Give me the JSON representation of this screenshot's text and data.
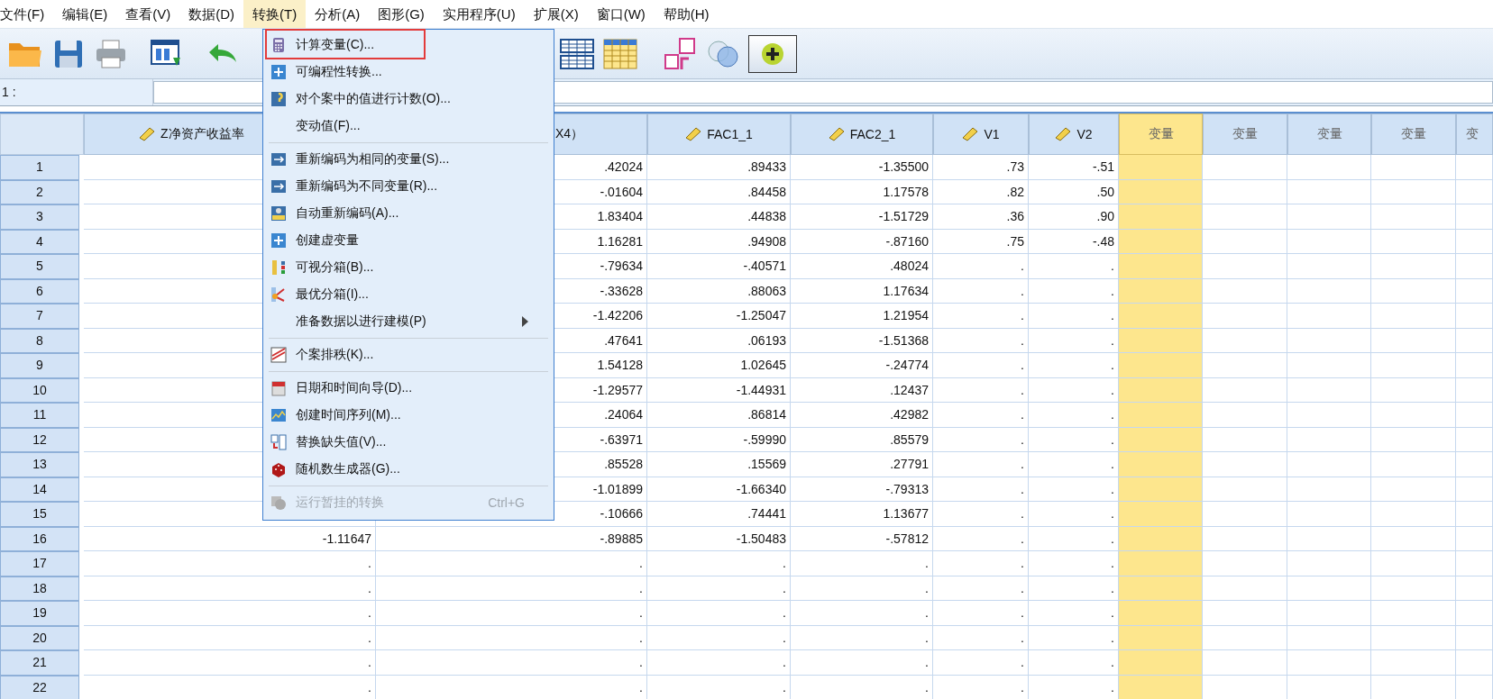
{
  "menu_bar": [
    {
      "label": "文件(F)",
      "selected": false
    },
    {
      "label": "编辑(E)",
      "selected": false
    },
    {
      "label": "查看(V)",
      "selected": false
    },
    {
      "label": "数据(D)",
      "selected": false
    },
    {
      "label": "转换(T)",
      "selected": true
    },
    {
      "label": "分析(A)",
      "selected": false
    },
    {
      "label": "图形(G)",
      "selected": false
    },
    {
      "label": "实用程序(U)",
      "selected": false
    },
    {
      "label": "扩展(X)",
      "selected": false
    },
    {
      "label": "窗口(W)",
      "selected": false
    },
    {
      "label": "帮助(H)",
      "selected": false
    }
  ],
  "cell_editor": {
    "cell_label": "1 :"
  },
  "transform_menu": {
    "items": [
      {
        "kind": "item",
        "label": "计算变量(C)...",
        "outlined": true,
        "disabled": false
      },
      {
        "kind": "item",
        "label": "可编程性转换...",
        "outlined": false,
        "disabled": false
      },
      {
        "kind": "item",
        "label": "对个案中的值进行计数(O)...",
        "outlined": false,
        "disabled": false
      },
      {
        "kind": "item",
        "label": "变动值(F)...",
        "outlined": false,
        "disabled": false
      },
      {
        "kind": "separator"
      },
      {
        "kind": "item",
        "label": "重新编码为相同的变量(S)...",
        "outlined": false,
        "disabled": false
      },
      {
        "kind": "item",
        "label": "重新编码为不同变量(R)...",
        "outlined": false,
        "disabled": false
      },
      {
        "kind": "item",
        "label": "自动重新编码(A)...",
        "outlined": false,
        "disabled": false
      },
      {
        "kind": "item",
        "label": "创建虚变量",
        "outlined": false,
        "disabled": false
      },
      {
        "kind": "item",
        "label": "可视分箱(B)...",
        "outlined": false,
        "disabled": false
      },
      {
        "kind": "item",
        "label": "最优分箱(I)...",
        "outlined": false,
        "disabled": false
      },
      {
        "kind": "submenu",
        "label": "准备数据以进行建模(P)",
        "outlined": false,
        "disabled": false
      },
      {
        "kind": "separator"
      },
      {
        "kind": "item",
        "label": "个案排秩(K)...",
        "outlined": false,
        "disabled": false
      },
      {
        "kind": "separator"
      },
      {
        "kind": "item",
        "label": "日期和时间向导(D)...",
        "outlined": false,
        "disabled": false
      },
      {
        "kind": "item",
        "label": "创建时间序列(M)...",
        "outlined": false,
        "disabled": false
      },
      {
        "kind": "item",
        "label": "替换缺失值(V)...",
        "outlined": false,
        "disabled": false
      },
      {
        "kind": "item",
        "label": "随机数生成器(G)...",
        "outlined": false,
        "disabled": false
      },
      {
        "kind": "separator"
      },
      {
        "kind": "item",
        "label": "运行暂挂的转换",
        "shortcut": "Ctrl+G",
        "outlined": false,
        "disabled": true
      }
    ]
  },
  "table": {
    "columns": [
      {
        "kind": "variable",
        "header": "Z净资产收益率",
        "selected": false
      },
      {
        "kind": "variable",
        "header": "X4）",
        "selected": false
      },
      {
        "kind": "variable",
        "header": "FAC1_1",
        "selected": false
      },
      {
        "kind": "variable",
        "header": "FAC2_1",
        "selected": false
      },
      {
        "kind": "variable",
        "header": "V1",
        "selected": false
      },
      {
        "kind": "variable",
        "header": "V2",
        "selected": false
      },
      {
        "kind": "empty",
        "header": "变量",
        "selected": true
      },
      {
        "kind": "empty",
        "header": "变量",
        "selected": false
      },
      {
        "kind": "empty",
        "header": "变量",
        "selected": false
      },
      {
        "kind": "empty",
        "header": "变量",
        "selected": false
      },
      {
        "kind": "empty",
        "header": "变",
        "selected": false
      }
    ],
    "rows": [
      {
        "number": "1",
        "cells": [
          null,
          ".42024",
          ".89433",
          "-1.35500",
          ".73",
          "-.51"
        ]
      },
      {
        "number": "2",
        "cells": [
          null,
          "-.01604",
          ".84458",
          "1.17578",
          ".82",
          ".50"
        ]
      },
      {
        "number": "3",
        "cells": [
          null,
          "1.83404",
          ".44838",
          "-1.51729",
          ".36",
          ".90"
        ]
      },
      {
        "number": "4",
        "cells": [
          null,
          "1.16281",
          ".94908",
          "-.87160",
          ".75",
          "-.48"
        ]
      },
      {
        "number": "5",
        "cells": [
          null,
          "-.79634",
          "-.40571",
          ".48024",
          ".",
          "."
        ]
      },
      {
        "number": "6",
        "cells": [
          null,
          "-.33628",
          ".88063",
          "1.17634",
          ".",
          "."
        ]
      },
      {
        "number": "7",
        "cells": [
          null,
          "-1.42206",
          "-1.25047",
          "1.21954",
          ".",
          "."
        ]
      },
      {
        "number": "8",
        "cells": [
          null,
          ".47641",
          ".06193",
          "-1.51368",
          ".",
          "."
        ]
      },
      {
        "number": "9",
        "cells": [
          null,
          "1.54128",
          "1.02645",
          "-.24774",
          ".",
          "."
        ]
      },
      {
        "number": "10",
        "cells": [
          null,
          "-1.29577",
          "-1.44931",
          ".12437",
          ".",
          "."
        ]
      },
      {
        "number": "11",
        "cells": [
          null,
          ".24064",
          ".86814",
          ".42982",
          ".",
          "."
        ]
      },
      {
        "number": "12",
        "cells": [
          null,
          "-.63971",
          "-.59990",
          ".85579",
          ".",
          "."
        ]
      },
      {
        "number": "13",
        "cells": [
          null,
          ".85528",
          ".15569",
          ".27791",
          ".",
          "."
        ]
      },
      {
        "number": "14",
        "cells": [
          null,
          "-1.01899",
          "-1.66340",
          "-.79313",
          ".",
          "."
        ]
      },
      {
        "number": "15",
        "cells": [
          null,
          "-.10666",
          ".74441",
          "1.13677",
          ".",
          "."
        ]
      },
      {
        "number": "16",
        "cells": [
          "-1.11647",
          "-.89885",
          "-1.50483",
          "-.57812",
          ".",
          "."
        ]
      },
      {
        "number": "17",
        "cells": [
          ".",
          ".",
          ".",
          ".",
          ".",
          "."
        ]
      },
      {
        "number": "18",
        "cells": [
          ".",
          ".",
          ".",
          ".",
          ".",
          "."
        ]
      },
      {
        "number": "19",
        "cells": [
          ".",
          ".",
          ".",
          ".",
          ".",
          "."
        ]
      },
      {
        "number": "20",
        "cells": [
          ".",
          ".",
          ".",
          ".",
          ".",
          "."
        ]
      },
      {
        "number": "21",
        "cells": [
          ".",
          ".",
          ".",
          ".",
          ".",
          "."
        ]
      },
      {
        "number": "22",
        "cells": [
          ".",
          ".",
          ".",
          ".",
          ".",
          "."
        ]
      }
    ]
  }
}
